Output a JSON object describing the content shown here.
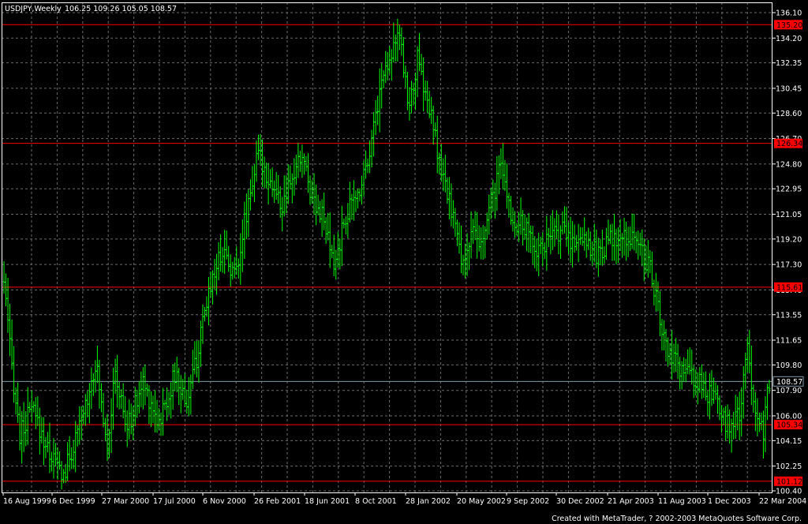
{
  "header": {
    "symbol": "USDJPY,Weekly",
    "ohlc": "106.25 109.26 105.05 108.57"
  },
  "footer": {
    "credit": "Created with MetaTrader, ? 2002-2003 MetaQuotes Software Corp."
  },
  "colors": {
    "background": "#000000",
    "grid": "#6b6b6b",
    "candles": "#00ff00",
    "level_line": "#ff0000",
    "price_line": "#7f9aa8",
    "text": "#ffffff"
  },
  "chart_data": {
    "type": "bar",
    "style": "ohlc",
    "timeframe": "weekly",
    "title": "USDJPY,Weekly",
    "grid": true,
    "ylim": [
      100.4,
      136.1
    ],
    "y_ticks": [
      "136.10",
      "134.20",
      "132.35",
      "130.45",
      "128.60",
      "126.70",
      "124.80",
      "122.95",
      "121.05",
      "119.20",
      "117.30",
      "115.40",
      "113.55",
      "111.65",
      "109.80",
      "107.90",
      "106.00",
      "104.15",
      "102.25",
      "100.40"
    ],
    "x_ticks": [
      "16 Aug 1999",
      "6 Dec 1999",
      "27 Mar 2000",
      "17 Jul 2000",
      "6 Nov 2000",
      "26 Feb 2001",
      "18 Jun 2001",
      "8 Oct 2001",
      "28 Jan 2002",
      "20 May 2002",
      "9 Sep 2002",
      "30 Dec 2002",
      "21 Apr 2003",
      "11 Aug 2003",
      "1 Dec 2003",
      "22 Mar 2004"
    ],
    "horizontal_levels": [
      135.2,
      126.34,
      115.61,
      105.34,
      101.12
    ],
    "horizontal_level_labels": [
      "135.20",
      "126.34",
      "115.61",
      "105.34",
      "101.12"
    ],
    "last_price": 108.57,
    "last_price_label": "108.57",
    "anchors": [
      [
        0,
        116.0
      ],
      [
        3,
        111.0
      ],
      [
        8,
        104.5
      ],
      [
        14,
        106.5
      ],
      [
        22,
        103.5
      ],
      [
        30,
        101.5
      ],
      [
        38,
        105.0
      ],
      [
        46,
        110.0
      ],
      [
        52,
        104.0
      ],
      [
        56,
        109.0
      ],
      [
        62,
        105.0
      ],
      [
        70,
        108.5
      ],
      [
        78,
        105.5
      ],
      [
        86,
        109.0
      ],
      [
        92,
        107.0
      ],
      [
        98,
        111.0
      ],
      [
        104,
        116.0
      ],
      [
        110,
        118.5
      ],
      [
        116,
        116.5
      ],
      [
        120,
        119.5
      ],
      [
        124,
        123.0
      ],
      [
        128,
        125.5
      ],
      [
        134,
        123.5
      ],
      [
        140,
        121.5
      ],
      [
        146,
        124.0
      ],
      [
        150,
        125.5
      ],
      [
        154,
        123.0
      ],
      [
        160,
        121.0
      ],
      [
        166,
        117.0
      ],
      [
        172,
        121.0
      ],
      [
        178,
        122.5
      ],
      [
        184,
        126.0
      ],
      [
        190,
        131.0
      ],
      [
        194,
        133.0
      ],
      [
        198,
        134.5
      ],
      [
        200,
        133.0
      ],
      [
        204,
        129.0
      ],
      [
        208,
        132.5
      ],
      [
        212,
        130.0
      ],
      [
        216,
        127.5
      ],
      [
        220,
        124.0
      ],
      [
        226,
        121.0
      ],
      [
        230,
        117.5
      ],
      [
        236,
        119.5
      ],
      [
        240,
        118.5
      ],
      [
        246,
        122.5
      ],
      [
        250,
        124.5
      ],
      [
        256,
        120.5
      ],
      [
        262,
        120.0
      ],
      [
        268,
        118.5
      ],
      [
        274,
        119.0
      ],
      [
        280,
        120.0
      ],
      [
        286,
        119.0
      ],
      [
        292,
        119.5
      ],
      [
        298,
        118.0
      ],
      [
        304,
        119.0
      ],
      [
        310,
        119.0
      ],
      [
        316,
        119.5
      ],
      [
        322,
        118.0
      ],
      [
        326,
        116.5
      ],
      [
        330,
        113.0
      ],
      [
        334,
        110.5
      ],
      [
        340,
        109.5
      ],
      [
        346,
        109.0
      ],
      [
        352,
        108.0
      ],
      [
        358,
        107.0
      ],
      [
        362,
        105.6
      ],
      [
        366,
        105.4
      ],
      [
        370,
        106.0
      ],
      [
        374,
        111.0
      ],
      [
        378,
        106.5
      ],
      [
        382,
        105.0
      ],
      [
        385,
        108.5
      ]
    ]
  }
}
